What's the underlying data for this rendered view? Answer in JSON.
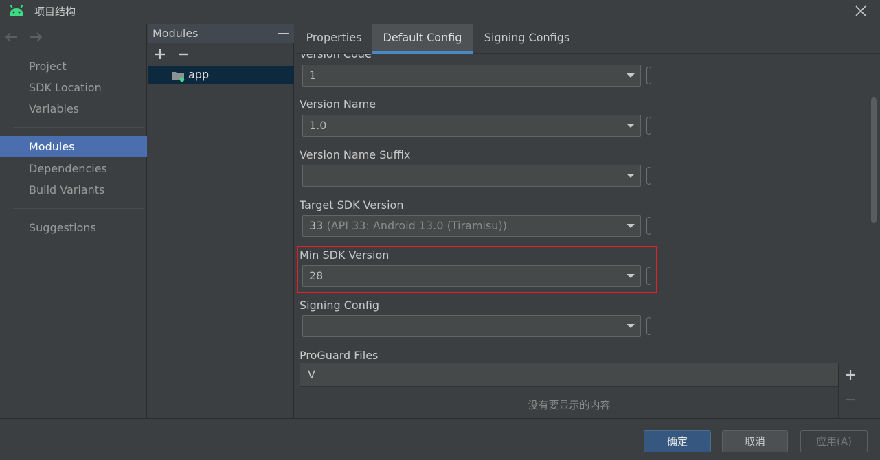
{
  "window": {
    "title": "项目结构"
  },
  "sidebar": {
    "groups": [
      {
        "items": [
          {
            "label": "Project"
          },
          {
            "label": "SDK Location"
          },
          {
            "label": "Variables"
          }
        ]
      },
      {
        "items": [
          {
            "label": "Modules"
          },
          {
            "label": "Dependencies"
          },
          {
            "label": "Build Variants"
          }
        ]
      },
      {
        "items": [
          {
            "label": "Suggestions"
          }
        ]
      }
    ],
    "selected": "Modules"
  },
  "modules": {
    "header": "Modules",
    "items": [
      {
        "name": "app"
      }
    ]
  },
  "tabs": [
    {
      "label": "Properties"
    },
    {
      "label": "Default Config"
    },
    {
      "label": "Signing Configs"
    }
  ],
  "active_tab": "Default Config",
  "form": {
    "fields": [
      {
        "label": "Version Code",
        "value": "1",
        "hint": ""
      },
      {
        "label": "Version Name",
        "value": "1.0",
        "hint": ""
      },
      {
        "label": "Version Name Suffix",
        "value": "",
        "hint": ""
      },
      {
        "label": "Target SDK Version",
        "value": "33",
        "hint": "(API 33: Android 13.0 (Tiramisu))"
      },
      {
        "label": "Min SDK Version",
        "value": "28",
        "hint": ""
      },
      {
        "label": "Signing Config",
        "value": "",
        "hint": ""
      }
    ],
    "proguard": {
      "label": "ProGuard Files",
      "column": "V",
      "empty_text": "没有要显示的内容"
    }
  },
  "footer": {
    "ok": "确定",
    "cancel": "取消",
    "apply": "应用(A)"
  },
  "colors": {
    "background": "#3c3f41",
    "selection": "#4b6eaf",
    "tab_underline": "#4a88c7",
    "highlight_box": "#e0202a",
    "primary_button": "#365880",
    "android_green": "#3ddc84"
  }
}
